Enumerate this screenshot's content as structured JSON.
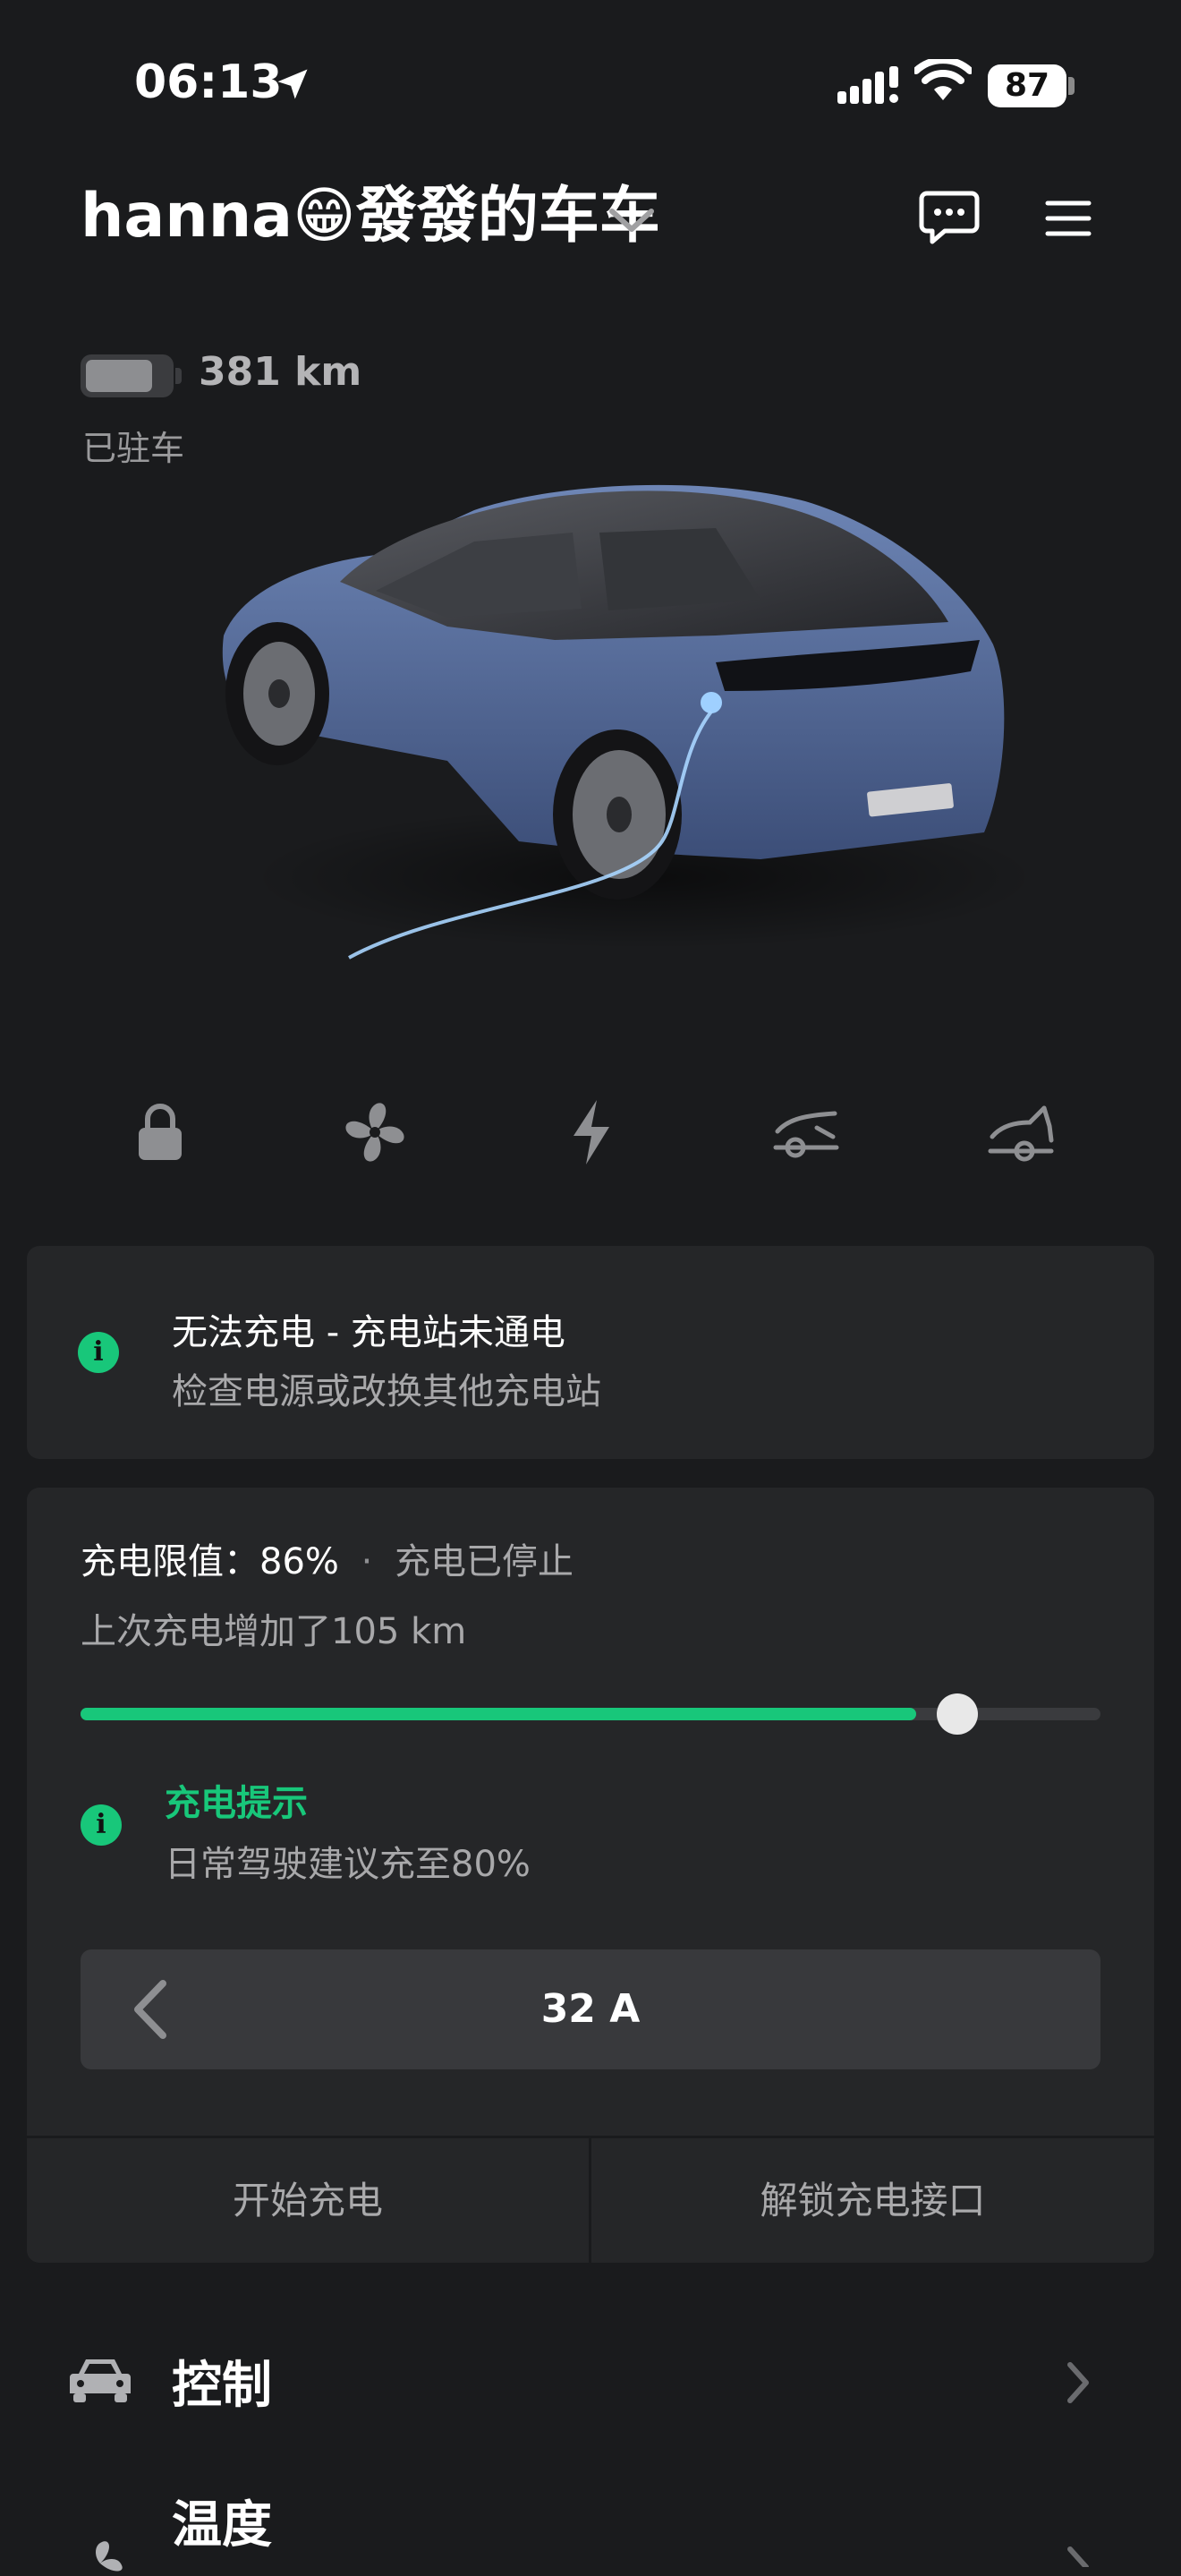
{
  "status_bar": {
    "time": "06:13",
    "battery_percent": "87",
    "icons": [
      "location-arrow-icon",
      "cellular-signal-icon",
      "wifi-icon",
      "battery-icon"
    ]
  },
  "vehicle": {
    "name": "hanna😁發發的车车",
    "range": "381 km",
    "battery_level": 0.8,
    "state": "已驻车"
  },
  "quick_actions": [
    {
      "icon": "lock-icon"
    },
    {
      "icon": "fan-icon"
    },
    {
      "icon": "charge-bolt-icon"
    },
    {
      "icon": "frunk-icon"
    },
    {
      "icon": "trunk-icon"
    }
  ],
  "alert": {
    "title": "无法充电 - 充电站未通电",
    "subtitle": "检查电源或改换其他充电站"
  },
  "charging": {
    "limit_label": "充电限值：",
    "limit_value": "86%",
    "separator": "·",
    "state": "充电已停止",
    "last_added": "上次充电增加了105 km",
    "limit_fraction": 0.86,
    "tip_title": "充电提示",
    "tip_text": "日常驾驶建议充至80%",
    "current": "32 A",
    "start_button": "开始充电",
    "unlock_button": "解锁充电接口"
  },
  "menu": [
    {
      "label": "控制",
      "icon": "car-icon"
    },
    {
      "label": "温度",
      "icon": "fan-icon"
    }
  ],
  "colors": {
    "background": "#1a1b1d",
    "card": "#252628",
    "accent_green": "#18c77a"
  }
}
